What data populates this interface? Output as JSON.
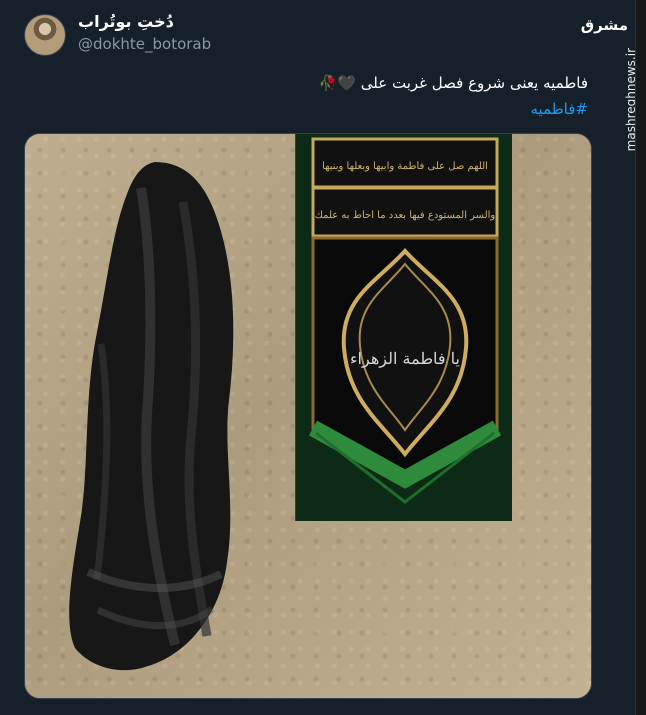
{
  "tweet": {
    "display_name": "دُختِ بوتُراب",
    "handle": "@dokhte_botorab",
    "text": "فاطمیه یعنی شروع فصل غربت علی 🖤🥀",
    "hashtag": "#فاطمیه"
  },
  "watermark": {
    "logo_text": "مشرق",
    "vertical_text": "mashreghnews.ir"
  },
  "banner_text": {
    "top_line_1": "اللهم صل علی فاطمة وابیها وبعلها وبنیها",
    "top_line_2": "والسر المستودع فیها بعدد ما احاط به علمك",
    "center": "یا فاطمة الزهراء"
  },
  "colors": {
    "background": "#15202b",
    "hashtag": "#1d9bf0",
    "muted": "#8b98a5",
    "banner_green": "#0f2f18",
    "gold": "#c8a85a"
  }
}
